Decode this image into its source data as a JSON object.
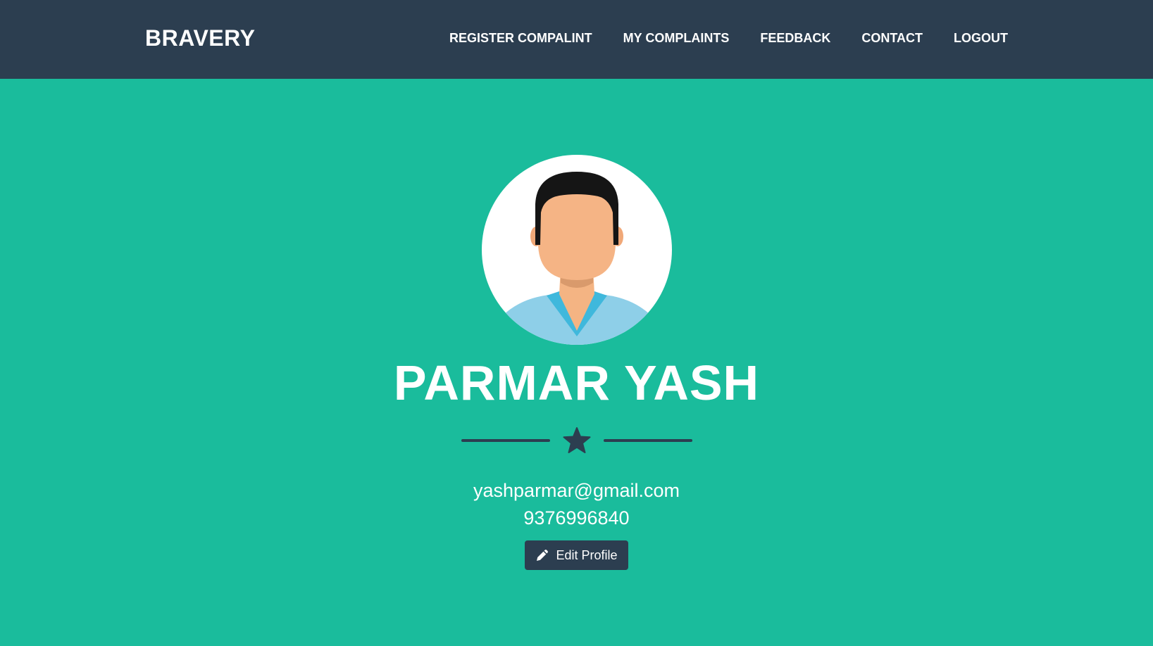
{
  "navbar": {
    "brand": "BRAVERY",
    "links": [
      {
        "label": "REGISTER COMPALINT"
      },
      {
        "label": "MY COMPLAINTS"
      },
      {
        "label": "FEEDBACK"
      },
      {
        "label": "CONTACT"
      },
      {
        "label": "LOGOUT"
      }
    ]
  },
  "profile": {
    "avatar_icon": "user-avatar-icon",
    "name": "PARMAR YASH",
    "divider_icon": "star-icon",
    "email": "yashparmar@gmail.com",
    "phone": "9376996840",
    "edit_button": {
      "icon": "pencil-icon",
      "label": "Edit Profile"
    }
  },
  "colors": {
    "navbar_bg": "#2c3e50",
    "page_bg": "#1abc9c",
    "text": "#ffffff",
    "button_bg": "#2c3e50"
  }
}
